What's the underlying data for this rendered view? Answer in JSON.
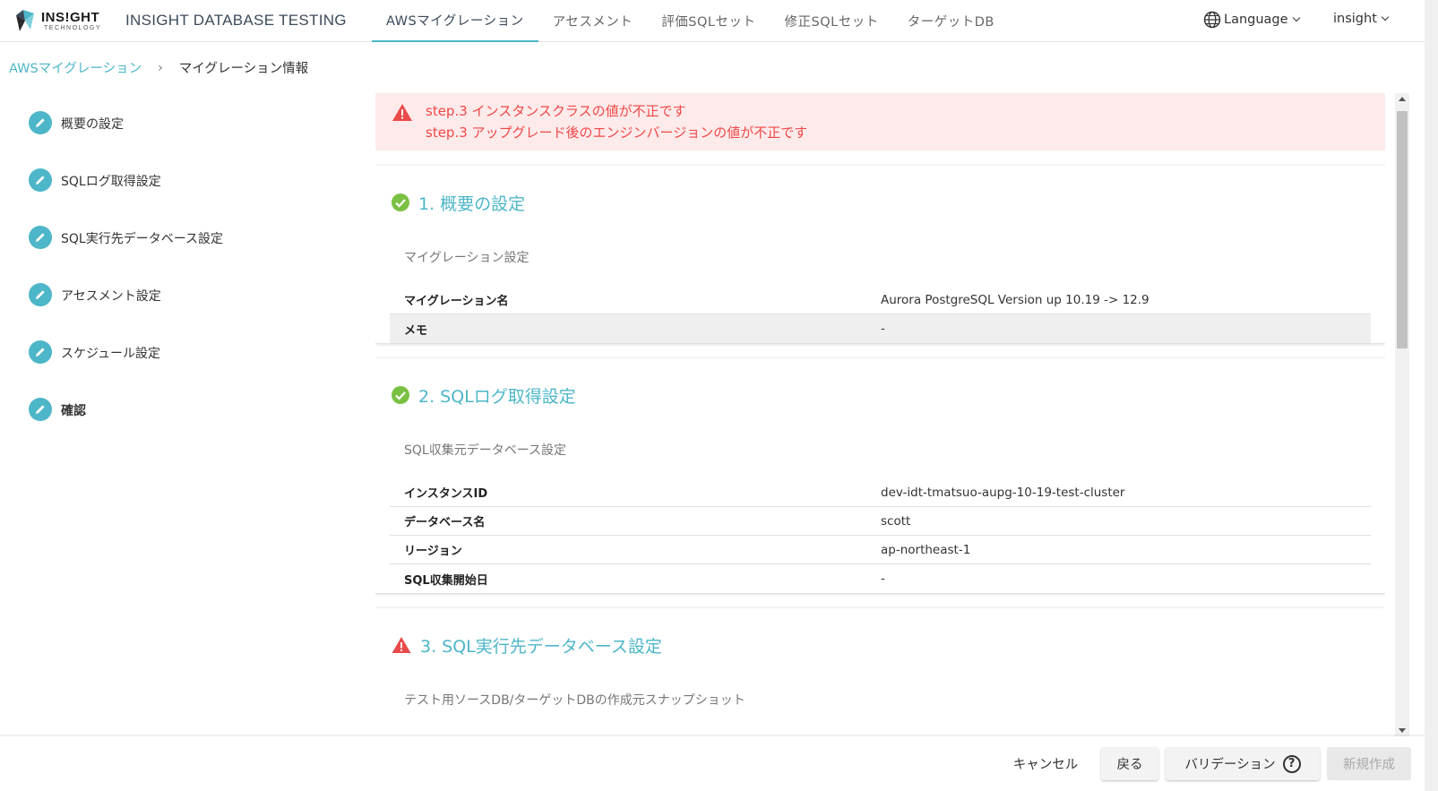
{
  "header": {
    "logo_main": "INS!GHT",
    "logo_sub": "TECHNOLOGY",
    "app_title": "INSIGHT DATABASE TESTING",
    "tabs": [
      {
        "label": "AWSマイグレーション",
        "active": true
      },
      {
        "label": "アセスメント",
        "active": false
      },
      {
        "label": "評価SQLセット",
        "active": false
      },
      {
        "label": "修正SQLセット",
        "active": false
      },
      {
        "label": "ターゲットDB",
        "active": false
      }
    ],
    "language_label": "Language",
    "user_label": "insight"
  },
  "breadcrumb": {
    "parent": "AWSマイグレーション",
    "separator": "›",
    "current": "マイグレーション情報"
  },
  "sidebar": {
    "items": [
      {
        "label": "概要の設定"
      },
      {
        "label": "SQLログ取得設定"
      },
      {
        "label": "SQL実行先データベース設定"
      },
      {
        "label": "アセスメント設定"
      },
      {
        "label": "スケジュール設定"
      },
      {
        "label": "確認"
      }
    ]
  },
  "alert": {
    "lines": [
      "step.3 インスタンスクラスの値が不正です",
      "step.3 アップグレード後のエンジンバージョンの値が不正です"
    ]
  },
  "cards": [
    {
      "title": "1. 概要の設定",
      "status": "ok",
      "section": "マイグレーション設定",
      "rows": [
        {
          "key": "マイグレーション名",
          "value": "Aurora PostgreSQL Version up 10.19 -> 12.9"
        },
        {
          "key": "メモ",
          "value": "-"
        }
      ]
    },
    {
      "title": "2. SQLログ取得設定",
      "status": "ok",
      "section": "SQL収集元データベース設定",
      "rows": [
        {
          "key": "インスタンスID",
          "value": "dev-idt-tmatsuo-aupg-10-19-test-cluster"
        },
        {
          "key": "データベース名",
          "value": "scott"
        },
        {
          "key": "リージョン",
          "value": "ap-northeast-1"
        },
        {
          "key": "SQL収集開始日",
          "value": "-"
        }
      ]
    },
    {
      "title": "3. SQL実行先データベース設定",
      "status": "error",
      "section": "テスト用ソースDB/ターゲットDBの作成元スナップショット"
    }
  ],
  "footer": {
    "cancel": "キャンセル",
    "back": "戻る",
    "validate": "バリデーション",
    "create": "新規作成"
  },
  "colors": {
    "accent": "#4db6c8",
    "ok": "#7ac143",
    "error": "#e94b4b",
    "alert_bg": "#fdeaea"
  }
}
